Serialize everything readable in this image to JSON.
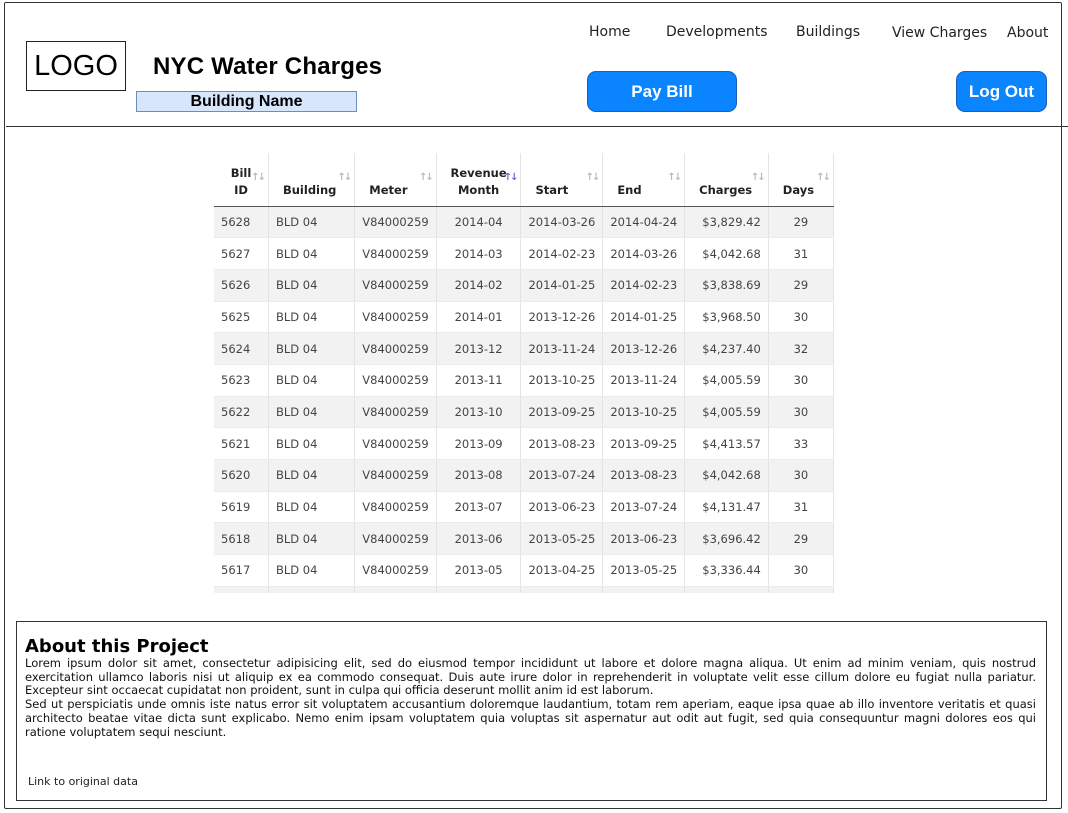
{
  "header": {
    "logo": "LOGO",
    "title": "NYC Water Charges",
    "building_name": "Building Name"
  },
  "nav": [
    "Home",
    "Developments",
    "Buildings",
    "View Charges",
    "About"
  ],
  "buttons": {
    "pay_bill": "Pay Bill",
    "log_out": "Log Out"
  },
  "table": {
    "columns": [
      {
        "line1": "Bill",
        "line2": "ID"
      },
      {
        "line1": "",
        "line2": "Building"
      },
      {
        "line1": "",
        "line2": "Meter"
      },
      {
        "line1": "Revenue",
        "line2": "Month"
      },
      {
        "line1": "",
        "line2": "Start"
      },
      {
        "line1": "",
        "line2": "End"
      },
      {
        "line1": "",
        "line2": "Charges"
      },
      {
        "line1": "",
        "line2": "Days"
      }
    ],
    "sorted_column": 3,
    "rows": [
      [
        "5628",
        "BLD 04",
        "V84000259",
        "2014-04",
        "2014-03-26",
        "2014-04-24",
        "$3,829.42",
        "29"
      ],
      [
        "5627",
        "BLD 04",
        "V84000259",
        "2014-03",
        "2014-02-23",
        "2014-03-26",
        "$4,042.68",
        "31"
      ],
      [
        "5626",
        "BLD 04",
        "V84000259",
        "2014-02",
        "2014-01-25",
        "2014-02-23",
        "$3,838.69",
        "29"
      ],
      [
        "5625",
        "BLD 04",
        "V84000259",
        "2014-01",
        "2013-12-26",
        "2014-01-25",
        "$3,968.50",
        "30"
      ],
      [
        "5624",
        "BLD 04",
        "V84000259",
        "2013-12",
        "2013-11-24",
        "2013-12-26",
        "$4,237.40",
        "32"
      ],
      [
        "5623",
        "BLD 04",
        "V84000259",
        "2013-11",
        "2013-10-25",
        "2013-11-24",
        "$4,005.59",
        "30"
      ],
      [
        "5622",
        "BLD 04",
        "V84000259",
        "2013-10",
        "2013-09-25",
        "2013-10-25",
        "$4,005.59",
        "30"
      ],
      [
        "5621",
        "BLD 04",
        "V84000259",
        "2013-09",
        "2013-08-23",
        "2013-09-25",
        "$4,413.57",
        "33"
      ],
      [
        "5620",
        "BLD 04",
        "V84000259",
        "2013-08",
        "2013-07-24",
        "2013-08-23",
        "$4,042.68",
        "30"
      ],
      [
        "5619",
        "BLD 04",
        "V84000259",
        "2013-07",
        "2013-06-23",
        "2013-07-24",
        "$4,131.47",
        "31"
      ],
      [
        "5618",
        "BLD 04",
        "V84000259",
        "2013-06",
        "2013-05-25",
        "2013-06-23",
        "$3,696.42",
        "29"
      ],
      [
        "5617",
        "BLD 04",
        "V84000259",
        "2013-05",
        "2013-04-25",
        "2013-05-25",
        "$3,336.44",
        "30"
      ]
    ]
  },
  "about": {
    "title": "About this Project",
    "paragraph1": "Lorem ipsum dolor sit amet, consectetur adipisicing elit, sed do eiusmod tempor incididunt ut labore et dolore magna aliqua. Ut enim ad minim veniam, quis nostrud exercitation ullamco laboris nisi ut aliquip ex ea commodo consequat. Duis aute irure dolor in reprehenderit in voluptate velit esse cillum dolore eu fugiat nulla pariatur. Excepteur sint occaecat cupidatat non proident, sunt in culpa qui officia deserunt mollit anim id est laborum.",
    "paragraph2": "Sed ut perspiciatis unde omnis iste natus error sit voluptatem accusantium doloremque laudantium, totam rem aperiam, eaque ipsa quae ab illo inventore veritatis et quasi architecto beatae vitae dicta sunt explicabo. Nemo enim ipsam voluptatem quia voluptas sit aspernatur aut odit aut fugit, sed quia consequuntur magni dolores eos qui ratione voluptatem sequi nesciunt.",
    "link": "Link to original data"
  }
}
